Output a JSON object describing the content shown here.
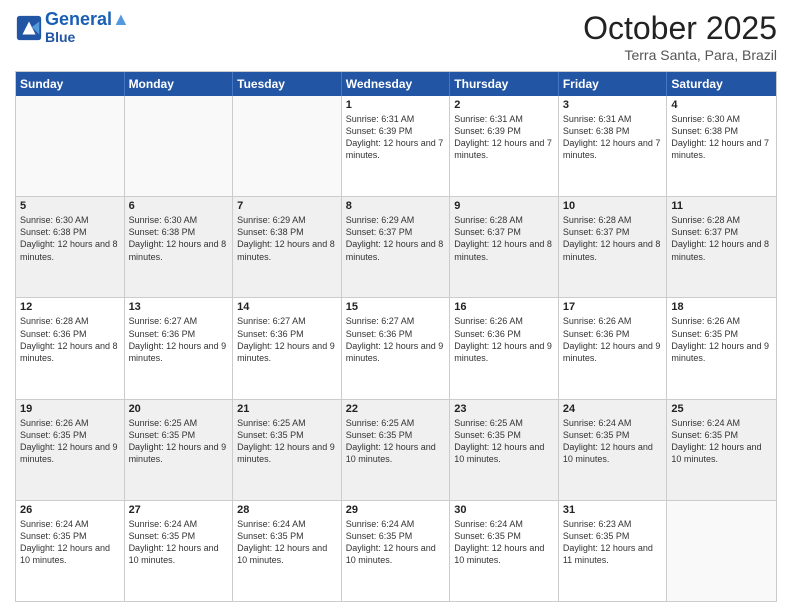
{
  "header": {
    "logo_line1": "General",
    "logo_line2": "Blue",
    "month": "October 2025",
    "location": "Terra Santa, Para, Brazil"
  },
  "weekdays": [
    "Sunday",
    "Monday",
    "Tuesday",
    "Wednesday",
    "Thursday",
    "Friday",
    "Saturday"
  ],
  "rows": [
    [
      {
        "day": "",
        "empty": true
      },
      {
        "day": "",
        "empty": true
      },
      {
        "day": "",
        "empty": true
      },
      {
        "day": "1",
        "sunrise": "Sunrise: 6:31 AM",
        "sunset": "Sunset: 6:39 PM",
        "daylight": "Daylight: 12 hours and 7 minutes."
      },
      {
        "day": "2",
        "sunrise": "Sunrise: 6:31 AM",
        "sunset": "Sunset: 6:39 PM",
        "daylight": "Daylight: 12 hours and 7 minutes."
      },
      {
        "day": "3",
        "sunrise": "Sunrise: 6:31 AM",
        "sunset": "Sunset: 6:38 PM",
        "daylight": "Daylight: 12 hours and 7 minutes."
      },
      {
        "day": "4",
        "sunrise": "Sunrise: 6:30 AM",
        "sunset": "Sunset: 6:38 PM",
        "daylight": "Daylight: 12 hours and 7 minutes."
      }
    ],
    [
      {
        "day": "5",
        "sunrise": "Sunrise: 6:30 AM",
        "sunset": "Sunset: 6:38 PM",
        "daylight": "Daylight: 12 hours and 8 minutes."
      },
      {
        "day": "6",
        "sunrise": "Sunrise: 6:30 AM",
        "sunset": "Sunset: 6:38 PM",
        "daylight": "Daylight: 12 hours and 8 minutes."
      },
      {
        "day": "7",
        "sunrise": "Sunrise: 6:29 AM",
        "sunset": "Sunset: 6:38 PM",
        "daylight": "Daylight: 12 hours and 8 minutes."
      },
      {
        "day": "8",
        "sunrise": "Sunrise: 6:29 AM",
        "sunset": "Sunset: 6:37 PM",
        "daylight": "Daylight: 12 hours and 8 minutes."
      },
      {
        "day": "9",
        "sunrise": "Sunrise: 6:28 AM",
        "sunset": "Sunset: 6:37 PM",
        "daylight": "Daylight: 12 hours and 8 minutes."
      },
      {
        "day": "10",
        "sunrise": "Sunrise: 6:28 AM",
        "sunset": "Sunset: 6:37 PM",
        "daylight": "Daylight: 12 hours and 8 minutes."
      },
      {
        "day": "11",
        "sunrise": "Sunrise: 6:28 AM",
        "sunset": "Sunset: 6:37 PM",
        "daylight": "Daylight: 12 hours and 8 minutes."
      }
    ],
    [
      {
        "day": "12",
        "sunrise": "Sunrise: 6:28 AM",
        "sunset": "Sunset: 6:36 PM",
        "daylight": "Daylight: 12 hours and 8 minutes."
      },
      {
        "day": "13",
        "sunrise": "Sunrise: 6:27 AM",
        "sunset": "Sunset: 6:36 PM",
        "daylight": "Daylight: 12 hours and 9 minutes."
      },
      {
        "day": "14",
        "sunrise": "Sunrise: 6:27 AM",
        "sunset": "Sunset: 6:36 PM",
        "daylight": "Daylight: 12 hours and 9 minutes."
      },
      {
        "day": "15",
        "sunrise": "Sunrise: 6:27 AM",
        "sunset": "Sunset: 6:36 PM",
        "daylight": "Daylight: 12 hours and 9 minutes."
      },
      {
        "day": "16",
        "sunrise": "Sunrise: 6:26 AM",
        "sunset": "Sunset: 6:36 PM",
        "daylight": "Daylight: 12 hours and 9 minutes."
      },
      {
        "day": "17",
        "sunrise": "Sunrise: 6:26 AM",
        "sunset": "Sunset: 6:36 PM",
        "daylight": "Daylight: 12 hours and 9 minutes."
      },
      {
        "day": "18",
        "sunrise": "Sunrise: 6:26 AM",
        "sunset": "Sunset: 6:35 PM",
        "daylight": "Daylight: 12 hours and 9 minutes."
      }
    ],
    [
      {
        "day": "19",
        "sunrise": "Sunrise: 6:26 AM",
        "sunset": "Sunset: 6:35 PM",
        "daylight": "Daylight: 12 hours and 9 minutes."
      },
      {
        "day": "20",
        "sunrise": "Sunrise: 6:25 AM",
        "sunset": "Sunset: 6:35 PM",
        "daylight": "Daylight: 12 hours and 9 minutes."
      },
      {
        "day": "21",
        "sunrise": "Sunrise: 6:25 AM",
        "sunset": "Sunset: 6:35 PM",
        "daylight": "Daylight: 12 hours and 9 minutes."
      },
      {
        "day": "22",
        "sunrise": "Sunrise: 6:25 AM",
        "sunset": "Sunset: 6:35 PM",
        "daylight": "Daylight: 12 hours and 10 minutes."
      },
      {
        "day": "23",
        "sunrise": "Sunrise: 6:25 AM",
        "sunset": "Sunset: 6:35 PM",
        "daylight": "Daylight: 12 hours and 10 minutes."
      },
      {
        "day": "24",
        "sunrise": "Sunrise: 6:24 AM",
        "sunset": "Sunset: 6:35 PM",
        "daylight": "Daylight: 12 hours and 10 minutes."
      },
      {
        "day": "25",
        "sunrise": "Sunrise: 6:24 AM",
        "sunset": "Sunset: 6:35 PM",
        "daylight": "Daylight: 12 hours and 10 minutes."
      }
    ],
    [
      {
        "day": "26",
        "sunrise": "Sunrise: 6:24 AM",
        "sunset": "Sunset: 6:35 PM",
        "daylight": "Daylight: 12 hours and 10 minutes."
      },
      {
        "day": "27",
        "sunrise": "Sunrise: 6:24 AM",
        "sunset": "Sunset: 6:35 PM",
        "daylight": "Daylight: 12 hours and 10 minutes."
      },
      {
        "day": "28",
        "sunrise": "Sunrise: 6:24 AM",
        "sunset": "Sunset: 6:35 PM",
        "daylight": "Daylight: 12 hours and 10 minutes."
      },
      {
        "day": "29",
        "sunrise": "Sunrise: 6:24 AM",
        "sunset": "Sunset: 6:35 PM",
        "daylight": "Daylight: 12 hours and 10 minutes."
      },
      {
        "day": "30",
        "sunrise": "Sunrise: 6:24 AM",
        "sunset": "Sunset: 6:35 PM",
        "daylight": "Daylight: 12 hours and 10 minutes."
      },
      {
        "day": "31",
        "sunrise": "Sunrise: 6:23 AM",
        "sunset": "Sunset: 6:35 PM",
        "daylight": "Daylight: 12 hours and 11 minutes."
      },
      {
        "day": "",
        "empty": true
      }
    ]
  ]
}
